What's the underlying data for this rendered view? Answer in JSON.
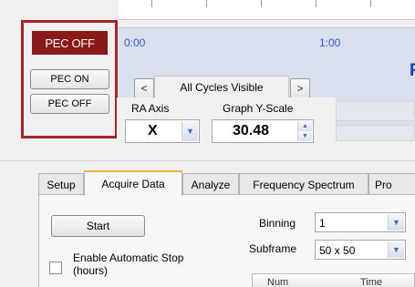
{
  "pec": {
    "status": "PEC OFF",
    "on_button": "PEC ON",
    "off_button": "PEC OFF"
  },
  "timeline": {
    "time_labels": [
      "0:00",
      "1:00"
    ],
    "truncated_title": "F"
  },
  "navigation": {
    "prev_label": "<",
    "next_label": ">",
    "cycles_label": "All Cycles Visible"
  },
  "ra_axis": {
    "label": "RA Axis",
    "value": "X"
  },
  "graph_scale": {
    "label": "Graph Y-Scale",
    "value": "30.48"
  },
  "tabs": [
    {
      "label": "Setup",
      "active": false
    },
    {
      "label": "Acquire Data",
      "active": true
    },
    {
      "label": "Analyze",
      "active": false
    },
    {
      "label": "Frequency Spectrum",
      "active": false
    },
    {
      "label": "Pro",
      "active": false
    }
  ],
  "acquire": {
    "start_button": "Start",
    "auto_stop_label": "Enable Automatic Stop (hours)",
    "auto_stop_checked": false,
    "binning_label": "Binning",
    "binning_value": "1",
    "subframe_label": "Subframe",
    "subframe_value": "50 x 50"
  },
  "grid": {
    "columns": [
      "Num",
      "Time"
    ]
  },
  "colors": {
    "highlight_border": "#a4262c",
    "pec_status_bg": "#8a1a1a",
    "time_text": "#3a56c8",
    "active_tab_accent": "#f2b034"
  }
}
